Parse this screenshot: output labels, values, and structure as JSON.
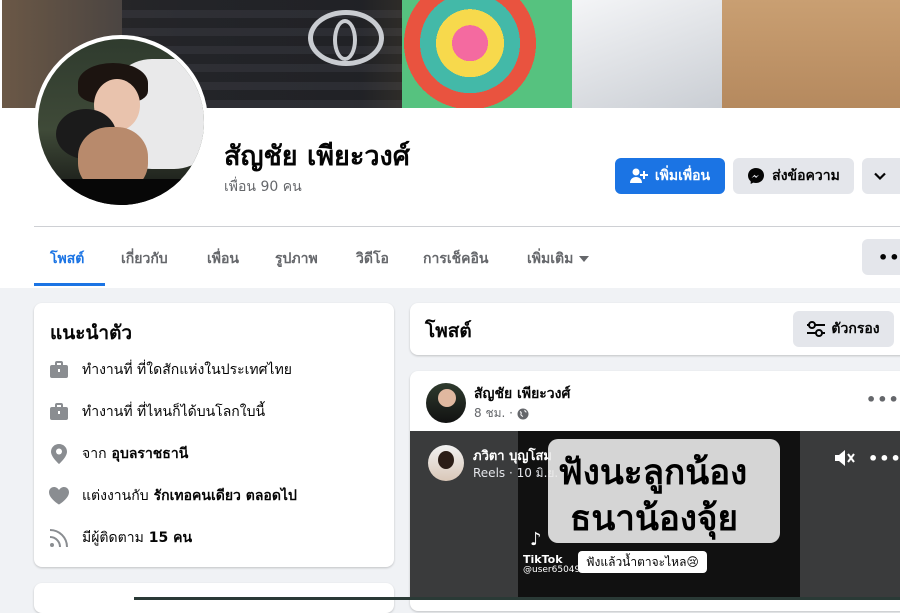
{
  "profile": {
    "name": "สัญชัย เพียะวงศ์",
    "friends": "เพื่อน 90 คน"
  },
  "actions": {
    "add_friend": "เพิ่มเพื่อน",
    "message": "ส่งข้อความ"
  },
  "tabs": [
    {
      "label": "โพสต์",
      "active": true
    },
    {
      "label": "เกี่ยวกับ"
    },
    {
      "label": "เพื่อน"
    },
    {
      "label": "รูปภาพ"
    },
    {
      "label": "วิดีโอ"
    },
    {
      "label": "การเช็คอิน"
    },
    {
      "label": "เพิ่มเติม"
    }
  ],
  "intro": {
    "title": "แนะนำตัว",
    "work1": "ทำงานที่ ที่ใดสักแห่งในประเทศไทย",
    "work2": "ทำงานที่ ที่ไหนก็ได้บนโลกใบนี้",
    "from_prefix": "จาก",
    "from_place": "อุบลราชธานี",
    "married_prefix": "แต่งงานกับ",
    "married_to": "รักเทอคนเดียว ตลอดไป",
    "followers_prefix": "มีผู้ติดตาม",
    "followers_count": "15 คน"
  },
  "posts": {
    "title": "โพสต์",
    "filter": "ตัวกรอง"
  },
  "post": {
    "author": "สัญชัย เพียะวงศ์",
    "time": "8 ชม. ·",
    "shared": {
      "author": "ภวิตา บุญโสม",
      "meta": "Reels · 10 มิ.ย. ·",
      "caption_line1": "ฟังนะลูกน้อง",
      "caption_line2": "ธนาน้องจุ้ย",
      "tiktok": "TikTok",
      "tiktok_user": "@user650498",
      "subtitle": "ฟังแล้วน้ำตาจะไหล😢"
    }
  },
  "colors": {
    "accent": "#1b74e4",
    "background": "#f0f2f5",
    "secondary_button": "#e4e6eb"
  },
  "icons": [
    "add-friend-icon",
    "messenger-icon",
    "chevron-down-icon",
    "briefcase-icon",
    "location-pin-icon",
    "heart-icon",
    "rss-feed-icon",
    "filter-sliders-icon",
    "globe-icon",
    "more-dots-icon",
    "mute-icon",
    "tiktok-icon"
  ]
}
